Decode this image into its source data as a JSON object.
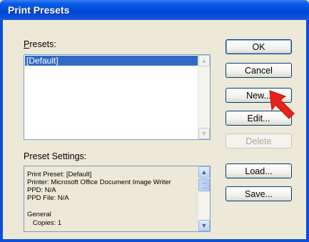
{
  "window": {
    "title": "Print Presets"
  },
  "presets": {
    "label": "Presets:",
    "items": [
      "[Default]"
    ]
  },
  "settings": {
    "label": "Preset Settings:",
    "lines": [
      "Print Preset: [Default]",
      "Printer: Microsoft Office Document Image Writer",
      "PPD: N/A",
      "PPD File: N/A",
      "",
      "General",
      "   Copies: 1"
    ]
  },
  "buttons": {
    "ok": "OK",
    "cancel": "Cancel",
    "new": "New...",
    "edit": "Edit...",
    "delete": "Delete",
    "load": "Load...",
    "save": "Save..."
  },
  "icons": {
    "annotation_arrow": "red-arrow-icon",
    "scroll_up": "scroll-up-icon",
    "scroll_down": "scroll-down-icon"
  },
  "colors": {
    "title_bar": "#0a4fd8",
    "selection": "#316ac5",
    "annotation_arrow": "#e8231b"
  }
}
